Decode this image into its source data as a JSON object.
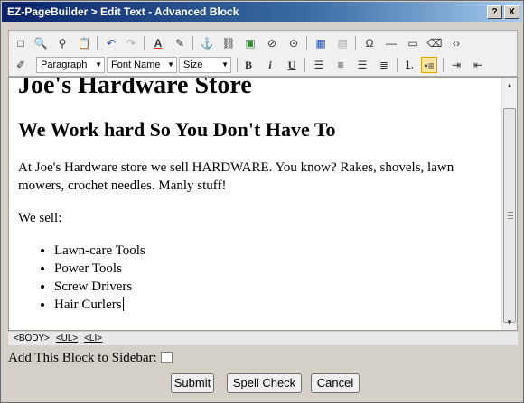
{
  "titlebar": {
    "title": "EZ-PageBuilder > Edit Text - Advanced Block",
    "help_label": "?",
    "close_label": "X"
  },
  "toolbar": {
    "paragraph_select": "Paragraph",
    "font_select": "Font Name",
    "size_select": "Size",
    "bold_label": "B",
    "italic_label": "i",
    "underline_label": "U",
    "row1_icons": [
      "new-doc-icon",
      "preview-icon",
      "find-icon",
      "paste-icon",
      "undo-icon",
      "redo-icon",
      "font-color-icon",
      "highlight-icon",
      "anchor-icon",
      "link-icon",
      "image-icon",
      "flash-icon",
      "media-icon",
      "table-icon",
      "table-props-icon",
      "special-char-icon",
      "horizontal-rule-icon",
      "form-icon",
      "eraser-icon",
      "source-code-icon"
    ],
    "row2_icons": [
      "style-icon",
      "align-left-icon",
      "align-center-icon",
      "align-right-icon",
      "justify-icon",
      "ordered-list-icon",
      "unordered-list-icon",
      "indent-icon",
      "outdent-icon"
    ]
  },
  "editor": {
    "heading1": "Joe's Hardware Store",
    "heading2": "We Work hard So You Don't Have To",
    "paragraph1": "At Joe's Hardware store we sell HARDWARE.  You know?  Rakes, shovels, lawn mowers, crochet needles. Manly stuff!",
    "paragraph2": "We sell:",
    "list": [
      "Lawn-care Tools",
      "Power Tools",
      "Screw Drivers",
      "Hair Curlers"
    ]
  },
  "statusbar": {
    "body": "<BODY>",
    "ul": "<UL>",
    "li": "<LI>"
  },
  "sidebar_option": {
    "label": "Add This Block to Sidebar:",
    "checked": false
  },
  "buttons": {
    "submit": "Submit",
    "spell_check": "Spell Check",
    "cancel": "Cancel"
  }
}
